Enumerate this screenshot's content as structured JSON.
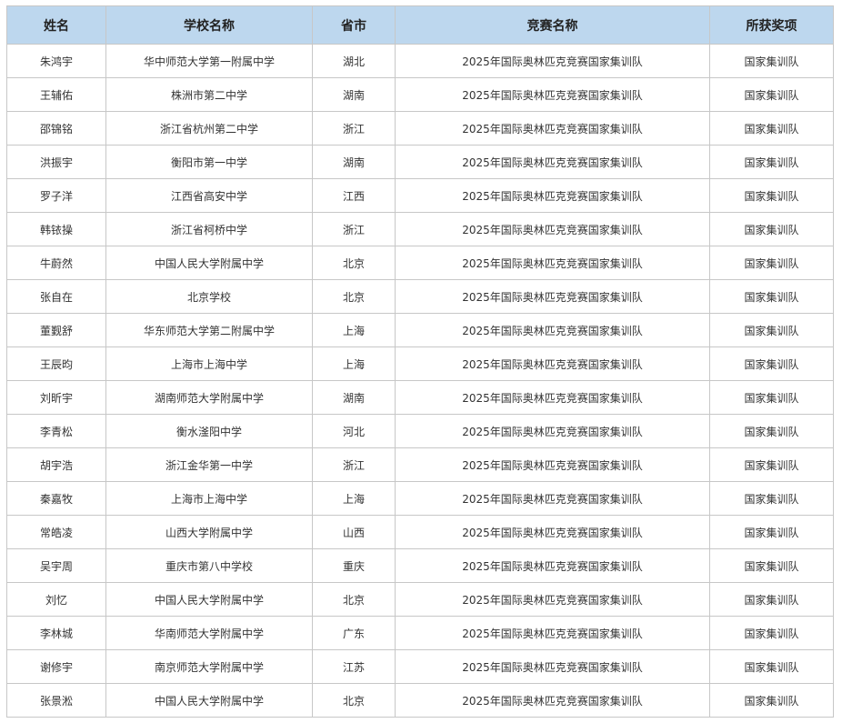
{
  "table": {
    "headers": [
      "姓名",
      "学校名称",
      "省市",
      "竞赛名称",
      "所获奖项"
    ],
    "rows": [
      [
        "朱鸿宇",
        "华中师范大学第一附属中学",
        "湖北",
        "2025年国际奥林匹克竞赛国家集训队",
        "国家集训队"
      ],
      [
        "王辅佑",
        "株洲市第二中学",
        "湖南",
        "2025年国际奥林匹克竞赛国家集训队",
        "国家集训队"
      ],
      [
        "邵锦铭",
        "浙江省杭州第二中学",
        "浙江",
        "2025年国际奥林匹克竞赛国家集训队",
        "国家集训队"
      ],
      [
        "洪振宇",
        "衡阳市第一中学",
        "湖南",
        "2025年国际奥林匹克竞赛国家集训队",
        "国家集训队"
      ],
      [
        "罗子洋",
        "江西省高安中学",
        "江西",
        "2025年国际奥林匹克竞赛国家集训队",
        "国家集训队"
      ],
      [
        "韩铱操",
        "浙江省柯桥中学",
        "浙江",
        "2025年国际奥林匹克竞赛国家集训队",
        "国家集训队"
      ],
      [
        "牛蔚然",
        "中国人民大学附属中学",
        "北京",
        "2025年国际奥林匹克竞赛国家集训队",
        "国家集训队"
      ],
      [
        "张自在",
        "北京学校",
        "北京",
        "2025年国际奥林匹克竞赛国家集训队",
        "国家集训队"
      ],
      [
        "董觐舒",
        "华东师范大学第二附属中学",
        "上海",
        "2025年国际奥林匹克竞赛国家集训队",
        "国家集训队"
      ],
      [
        "王辰昀",
        "上海市上海中学",
        "上海",
        "2025年国际奥林匹克竞赛国家集训队",
        "国家集训队"
      ],
      [
        "刘昕宇",
        "湖南师范大学附属中学",
        "湖南",
        "2025年国际奥林匹克竞赛国家集训队",
        "国家集训队"
      ],
      [
        "李青松",
        "衡水滏阳中学",
        "河北",
        "2025年国际奥林匹克竞赛国家集训队",
        "国家集训队"
      ],
      [
        "胡宇浩",
        "浙江金华第一中学",
        "浙江",
        "2025年国际奥林匹克竞赛国家集训队",
        "国家集训队"
      ],
      [
        "秦嘉牧",
        "上海市上海中学",
        "上海",
        "2025年国际奥林匹克竞赛国家集训队",
        "国家集训队"
      ],
      [
        "常皓凌",
        "山西大学附属中学",
        "山西",
        "2025年国际奥林匹克竞赛国家集训队",
        "国家集训队"
      ],
      [
        "吴宇周",
        "重庆市第八中学校",
        "重庆",
        "2025年国际奥林匹克竞赛国家集训队",
        "国家集训队"
      ],
      [
        "刘忆",
        "中国人民大学附属中学",
        "北京",
        "2025年国际奥林匹克竞赛国家集训队",
        "国家集训队"
      ],
      [
        "李林城",
        "华南师范大学附属中学",
        "广东",
        "2025年国际奥林匹克竞赛国家集训队",
        "国家集训队"
      ],
      [
        "谢修宇",
        "南京师范大学附属中学",
        "江苏",
        "2025年国际奥林匹克竞赛国家集训队",
        "国家集训队"
      ],
      [
        "张景淞",
        "中国人民大学附属中学",
        "北京",
        "2025年国际奥林匹克竞赛国家集训队",
        "国家集训队"
      ]
    ]
  },
  "colors": {
    "header_bg": "#bdd7ee",
    "border": "#c7c7c7",
    "text": "#333333"
  }
}
